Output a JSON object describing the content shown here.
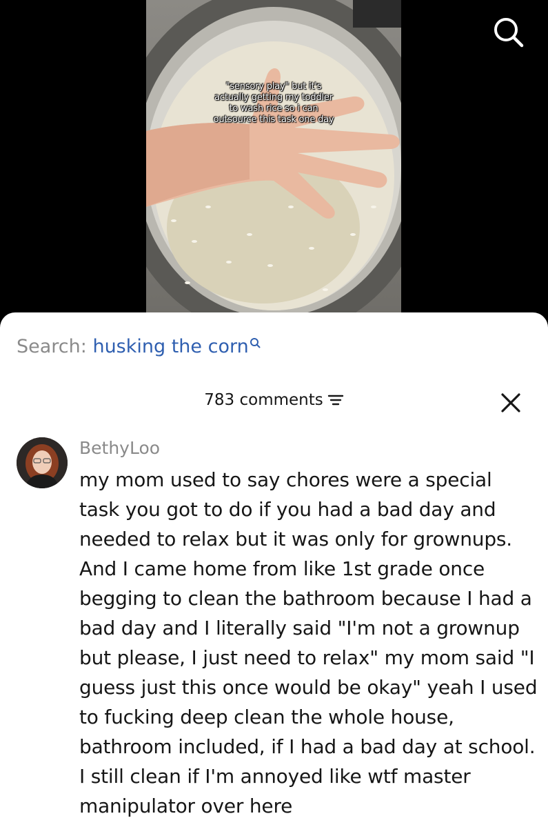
{
  "video": {
    "caption": "\"sensory play\" but it's\nactually getting my toddler\nto wash rice so i can\noutsource this task one day"
  },
  "top_bar": {
    "search_icon": "search-icon"
  },
  "sheet": {
    "search_prefix": "Search: ",
    "search_term": "husking the corn",
    "comments_count_label": "783 comments",
    "filter_icon": "filter-lines-icon",
    "close_icon": "close-icon"
  },
  "comments": [
    {
      "username": "BethyLoo",
      "text": "my mom used to say chores were a special task you got to do if you had a bad day and needed to relax but it was only for grownups. And I came home from like 1st grade once begging to clean the bathroom because I had a bad day and I literally said \"I'm not a grownup but please, I just need to relax\" my mom said \"I guess just this once would be okay\" yeah I used to fucking deep clean the whole house, bathroom included, if I had a bad day at school. I still clean if I'm annoyed like wtf master manipulator over here"
    }
  ],
  "colors": {
    "link_blue": "#2f5fb0",
    "muted_gray": "#8a8a8a",
    "text_dark": "#161616",
    "sheet_bg": "#ffffff",
    "video_bg": "#000000"
  }
}
